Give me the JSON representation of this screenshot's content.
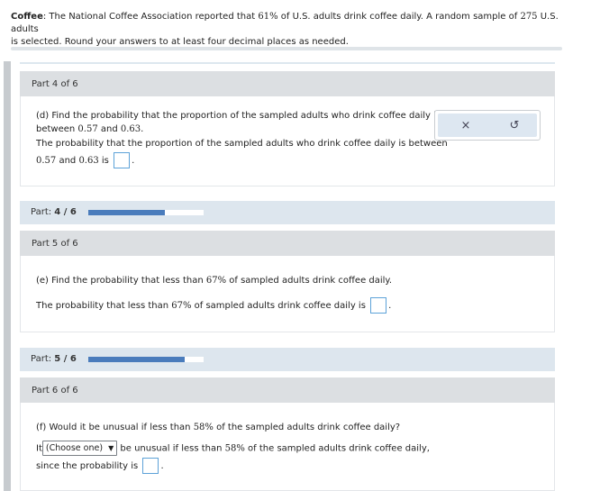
{
  "intro": {
    "bold": "Coffee",
    "text1": ": The National Coffee Association reported that ",
    "pct": "61%",
    "text2": " of U.S. adults drink coffee daily. A random sample of ",
    "n": "275",
    "text3": " U.S. adults",
    "line2": "is selected. Round your answers to at least four decimal places as needed."
  },
  "part4": {
    "header": "Part 4 of 6",
    "q_line1": "(d) Find the probability that the proportion of the sampled adults who drink coffee daily is",
    "q_line2_a": "between ",
    "q_line2_v1": "0.57",
    "q_line2_b": " and ",
    "q_line2_v2": "0.63",
    "q_line2_c": ".",
    "a_line1": "The probability that the proportion of the sampled adults who drink coffee daily is between",
    "a_line2_v1": "0.57",
    "a_line2_b": " and ",
    "a_line2_v2": "0.63",
    "a_line2_c": " is",
    "period": "."
  },
  "tools": {
    "clear_icon": "×",
    "undo_icon": "↺"
  },
  "progress4": {
    "prefix": "Part: ",
    "value": "4 / 6",
    "fraction": 0.667
  },
  "part5": {
    "header": "Part 5 of 6",
    "q_a": "(e) Find the probability that less than ",
    "q_pct": "67%",
    "q_b": " of sampled adults drink coffee daily.",
    "a_a": "The probability that less than ",
    "a_pct": "67%",
    "a_b": " of sampled adults drink coffee daily is",
    "period": "."
  },
  "progress5": {
    "prefix": "Part: ",
    "value": "5 / 6",
    "fraction": 0.833
  },
  "part6": {
    "header": "Part 6 of 6",
    "q_a": "(f) Would it be unusual if less than ",
    "q_pct": "58%",
    "q_b": " of the sampled adults drink coffee daily?",
    "it": "It",
    "select_value": "(Choose one)",
    "select_caret": "▼",
    "a_b": " be unusual if less than ",
    "a_pct": "58%",
    "a_c": " of the sampled adults drink coffee daily,",
    "since": "since the probability is",
    "period": "."
  }
}
